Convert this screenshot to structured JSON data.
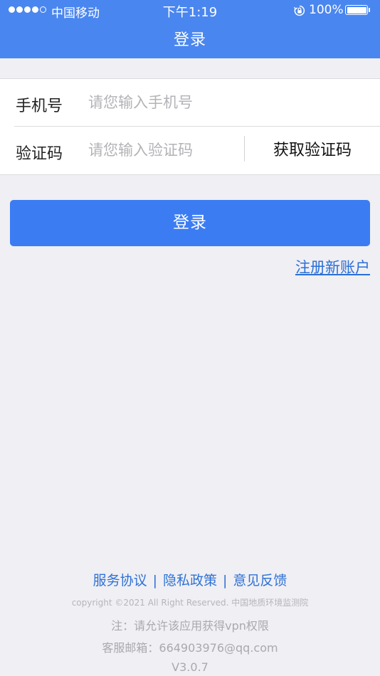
{
  "status_bar": {
    "carrier": "中国移动",
    "time": "下午1:19",
    "battery": "100%",
    "signal_bars_filled": 4,
    "signal_bars_total": 5
  },
  "nav": {
    "title": "登录"
  },
  "form": {
    "phone_label": "手机号",
    "phone_placeholder": "请您输入手机号",
    "phone_value": "",
    "code_label": "验证码",
    "code_placeholder": "请您输入验证码",
    "code_value": "",
    "get_code_label": "获取验证码"
  },
  "actions": {
    "login_label": "登录",
    "register_label": "注册新账户"
  },
  "footer": {
    "links": [
      "服务协议",
      "隐私政策",
      "意见反馈"
    ],
    "separator": "|",
    "copyright": "copyright ©2021 All Right Reserved. 中国地质环境监测院",
    "note": "注：请允许该应用获得vpn权限",
    "email": "客服邮箱：664903976@qq.com",
    "version": "V3.0.7"
  },
  "colors": {
    "brand_blue": "#4a86ef",
    "button_blue": "#3b7cf2",
    "link_blue": "#2b6fd6",
    "background": "#efeff4"
  },
  "icons": {
    "signal": "signal-dots-icon",
    "rotation_lock": "rotation-lock-icon",
    "battery": "battery-icon"
  }
}
